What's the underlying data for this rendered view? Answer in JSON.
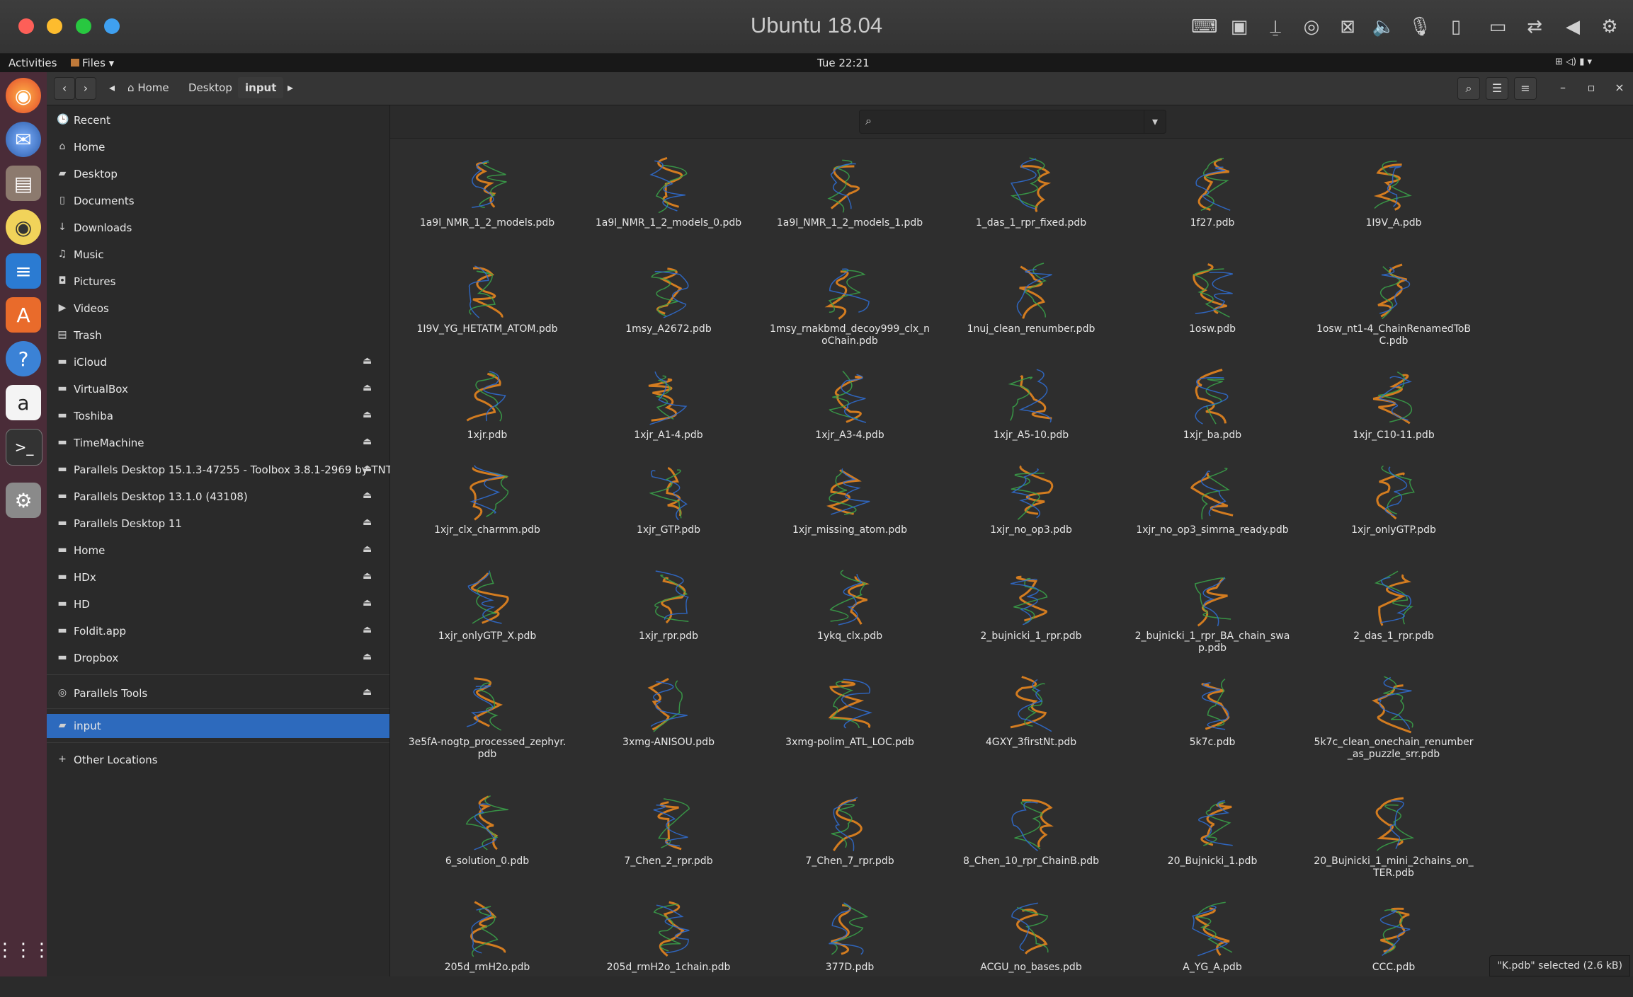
{
  "host": {
    "title": "Ubuntu 18.04",
    "traffic_colors": [
      "#fd5f58",
      "#fdbc2e",
      "#28c840",
      "#3fa0f0"
    ],
    "toolbar_icons": [
      "keyboard-icon",
      "cpu-icon",
      "usb-icon",
      "cd-icon",
      "network-icon",
      "volume-icon",
      "microphone-icon",
      "sd-card-icon",
      "camera-icon",
      "shared-folder-icon",
      "back-icon",
      "settings-icon"
    ]
  },
  "panel": {
    "activities": "Activities",
    "app_menu": "Files ▾",
    "clock": "Tue 22:21"
  },
  "dock": {
    "items": [
      "firefox-icon",
      "thunderbird-icon",
      "files-icon",
      "rhythmbox-icon",
      "writer-icon",
      "software-center-icon",
      "help-icon",
      "amazon-icon",
      "terminal-icon",
      "settings-tools-icon"
    ],
    "apps_grid": "show-apps-icon"
  },
  "header": {
    "back": "‹",
    "forward": "›",
    "crumb_prev": "◂",
    "crumb_next": "▸",
    "breadcrumbs": [
      "Home",
      "Desktop",
      "input"
    ],
    "search_icon": "search-icon",
    "view_icon": "list-view-icon",
    "menu_icon": "menu-icon",
    "window": {
      "minimize": "–",
      "maximize": "▫",
      "close": "×"
    }
  },
  "sidebar": {
    "places": [
      {
        "label": "Recent",
        "icon": "🕒"
      },
      {
        "label": "Home",
        "icon": "⌂"
      },
      {
        "label": "Desktop",
        "icon": "▰"
      },
      {
        "label": "Documents",
        "icon": "▯"
      },
      {
        "label": "Downloads",
        "icon": "↓"
      },
      {
        "label": "Music",
        "icon": "♫"
      },
      {
        "label": "Pictures",
        "icon": "◘"
      },
      {
        "label": "Videos",
        "icon": "▶"
      },
      {
        "label": "Trash",
        "icon": "▤"
      }
    ],
    "devices": [
      "iCloud",
      "VirtualBox",
      "Toshiba",
      "TimeMachine",
      "Parallels Desktop 15.1.3-47255 - Toolbox 3.8.1-2969 by TNT",
      "Parallels Desktop 13.1.0 (43108)",
      "Parallels Desktop 11",
      "Home",
      "HDx",
      "HD",
      "Foldit.app",
      "Dropbox"
    ],
    "parallels_tools": "Parallels Tools",
    "bookmark_selected": "input",
    "other_locations": "Other Locations",
    "eject": "⏏"
  },
  "main": {
    "search_placeholder": "",
    "dropdown": "▾",
    "files": [
      [
        "1a9l_NMR_1_2_models.pdb",
        "1a9l_NMR_1_2_models_0.pdb",
        "1a9l_NMR_1_2_models_1.pdb",
        "1_das_1_rpr_fixed.pdb",
        "1f27.pdb",
        "1I9V_A.pdb"
      ],
      [
        "1I9V_YG_HETATM_ATOM.pdb",
        "1msy_A2672.pdb",
        "1msy_rnakbmd_decoy999_clx_noChain.pdb",
        "1nuj_clean_renumber.pdb",
        "1osw.pdb",
        "1osw_nt1-4_ChainRenamedToBC.pdb"
      ],
      [
        "1xjr.pdb",
        "1xjr_A1-4.pdb",
        "1xjr_A3-4.pdb",
        "1xjr_A5-10.pdb",
        "1xjr_ba.pdb",
        "1xjr_C10-11.pdb"
      ],
      [
        "1xjr_clx_charmm.pdb",
        "1xjr_GTP.pdb",
        "1xjr_missing_atom.pdb",
        "1xjr_no_op3.pdb",
        "1xjr_no_op3_simrna_ready.pdb",
        "1xjr_onlyGTP.pdb"
      ],
      [
        "1xjr_onlyGTP_X.pdb",
        "1xjr_rpr.pdb",
        "1ykq_clx.pdb",
        "2_bujnicki_1_rpr.pdb",
        "2_bujnicki_1_rpr_BA_chain_swap.pdb",
        "2_das_1_rpr.pdb"
      ],
      [
        "3e5fA-nogtp_processed_zephyr.pdb",
        "3xmg-ANISOU.pdb",
        "3xmg-polim_ATL_LOC.pdb",
        "4GXY_3firstNt.pdb",
        "5k7c.pdb",
        "5k7c_clean_onechain_renumber_as_puzzle_srr.pdb"
      ],
      [
        "6_solution_0.pdb",
        "7_Chen_2_rpr.pdb",
        "7_Chen_7_rpr.pdb",
        "8_Chen_10_rpr_ChainB.pdb",
        "20_Bujnicki_1.pdb",
        "20_Bujnicki_1_mini_2chains_on_TER.pdb"
      ],
      [
        "205d_rmH2o.pdb",
        "205d_rmH2o_1chain.pdb",
        "377D.pdb",
        "ACGU_no_bases.pdb",
        "A_YG_A.pdb",
        "CCC.pdb"
      ]
    ],
    "status": "\"K.pdb\" selected (2.6 kB)"
  },
  "colors": {
    "selected": "#2d6abd",
    "dock_bg": "#4a2c38",
    "rna_orange": "#f08a1d",
    "rna_green": "#3aa64a",
    "rna_blue": "#2f6fd6"
  }
}
